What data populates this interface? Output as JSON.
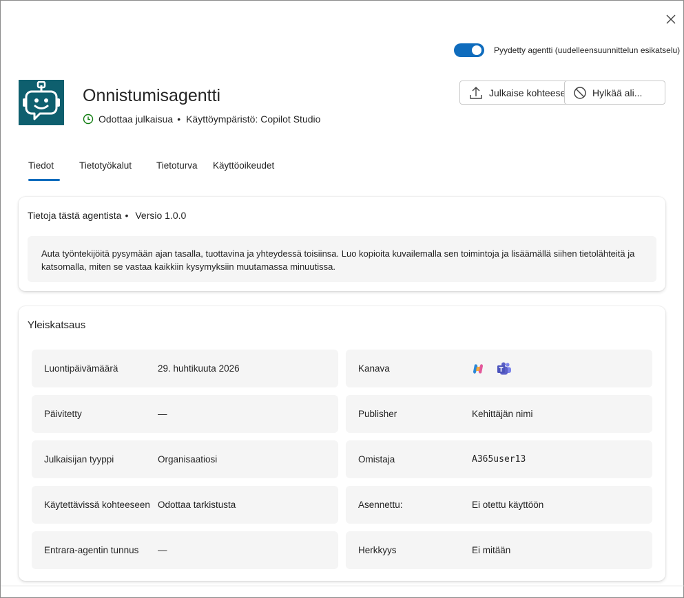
{
  "toggle": {
    "label": "Pyydetty agentti (uudelleensuunnittelun esikatselu)",
    "state": "on"
  },
  "agent": {
    "name": "Onnistumisagentti",
    "status": "Odottaa julkaisua",
    "separator": "•",
    "environment": "Käyttöympäristö: Copilot Studio"
  },
  "actions": {
    "publish_label": "Julkaise kohteeseen...",
    "reject_label": "Hylkää ali..."
  },
  "tabs": [
    {
      "label": "Tiedot",
      "active": true
    },
    {
      "label": "Tietotyökalut",
      "active": false
    },
    {
      "label": "Tietoturva",
      "active": false
    },
    {
      "label": "Käyttöoikeudet",
      "active": false
    }
  ],
  "about": {
    "heading": "Tietoja tästä agentista",
    "version": "Versio 1.0.0",
    "description": "Auta työntekijöitä pysymään ajan tasalla, tuottavina ja yhteydessä toisiinsa. Luo kopioita kuvailemalla sen toimintoja ja lisäämällä siihen tietolähteitä ja katsomalla, miten se vastaa kaikkiin kysymyksiin muutamassa minuutissa."
  },
  "overview": {
    "title": "Yleiskatsaus",
    "left": [
      {
        "label": "Luontipäivämäärä",
        "value": "29. huhtikuuta 2026"
      },
      {
        "label": "Päivitetty",
        "value": "—"
      },
      {
        "label": "Julkaisijan tyyppi",
        "value": "Organisaatiosi"
      },
      {
        "label": "Käytettävissä kohteeseen",
        "value": "Odottaa tarkistusta"
      },
      {
        "label": "Entrara-agentin tunnus",
        "value": "—"
      }
    ],
    "right": [
      {
        "label": "Kanava",
        "value": "",
        "icons": [
          "copilot-icon",
          "teams-icon"
        ]
      },
      {
        "label": "Publisher",
        "value": "Kehittäjän nimi"
      },
      {
        "label": "Omistaja",
        "value": "A365user13"
      },
      {
        "label": "Asennettu:",
        "value": "Ei otettu käyttöön"
      },
      {
        "label": "Herkkyys",
        "value": "Ei mitään"
      }
    ]
  },
  "colors": {
    "accent": "#0f6cbd",
    "agent_icon_bg": "#0e5f6e",
    "status_green": "#107c10",
    "cell_bg": "#f5f5f5",
    "teams_purple": "#5b5fc7"
  }
}
